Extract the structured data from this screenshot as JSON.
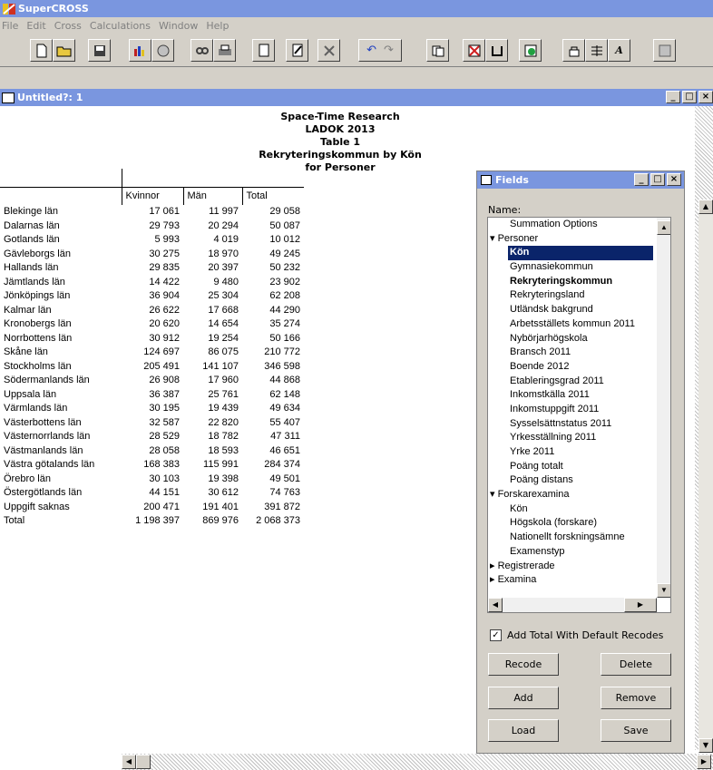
{
  "app": {
    "title": "SuperCROSS"
  },
  "menu": [
    "File",
    "Edit",
    "Cross",
    "Calculations",
    "Window",
    "Help"
  ],
  "toolbar": {
    "icons": [
      "new-icon",
      "open-icon",
      "save-icon",
      "chart-icon",
      "map-icon",
      "find-icon",
      "print-icon",
      "preview-icon",
      "edit-icon",
      "tools-icon",
      "undo-icon",
      "redo-icon",
      "paste-icon",
      "delete-icon",
      "clear-icon",
      "add-icon",
      "lock-icon",
      "columns-icon",
      "font-icon",
      "window-icon"
    ]
  },
  "window": {
    "title": "Untitled?: 1"
  },
  "report": {
    "line1": "Space-Time Research",
    "line2": "LADOK 2013",
    "line3": "Table 1",
    "line4": "Rekryteringskommun by Kön",
    "line5": "for Personer"
  },
  "table": {
    "columns": [
      "Kvinnor",
      "Män",
      "Total"
    ],
    "rows": [
      {
        "name": "Blekinge län",
        "k": "17 061",
        "m": "11 997",
        "t": "29 058"
      },
      {
        "name": "Dalarnas län",
        "k": "29 793",
        "m": "20 294",
        "t": "50 087"
      },
      {
        "name": "Gotlands län",
        "k": "5 993",
        "m": "4 019",
        "t": "10 012"
      },
      {
        "name": "Gävleborgs län",
        "k": "30 275",
        "m": "18 970",
        "t": "49 245"
      },
      {
        "name": "Hallands län",
        "k": "29 835",
        "m": "20 397",
        "t": "50 232"
      },
      {
        "name": "Jämtlands län",
        "k": "14 422",
        "m": "9 480",
        "t": "23 902"
      },
      {
        "name": "Jönköpings län",
        "k": "36 904",
        "m": "25 304",
        "t": "62 208"
      },
      {
        "name": "Kalmar län",
        "k": "26 622",
        "m": "17 668",
        "t": "44 290"
      },
      {
        "name": "Kronobergs län",
        "k": "20 620",
        "m": "14 654",
        "t": "35 274"
      },
      {
        "name": "Norrbottens län",
        "k": "30 912",
        "m": "19 254",
        "t": "50 166"
      },
      {
        "name": "Skåne län",
        "k": "124 697",
        "m": "86 075",
        "t": "210 772"
      },
      {
        "name": "Stockholms län",
        "k": "205 491",
        "m": "141 107",
        "t": "346 598"
      },
      {
        "name": "Södermanlands län",
        "k": "26 908",
        "m": "17 960",
        "t": "44 868"
      },
      {
        "name": "Uppsala län",
        "k": "36 387",
        "m": "25 761",
        "t": "62 148"
      },
      {
        "name": "Värmlands län",
        "k": "30 195",
        "m": "19 439",
        "t": "49 634"
      },
      {
        "name": "Västerbottens län",
        "k": "32 587",
        "m": "22 820",
        "t": "55 407"
      },
      {
        "name": "Västernorrlands län",
        "k": "28 529",
        "m": "18 782",
        "t": "47 311"
      },
      {
        "name": "Västmanlands län",
        "k": "28 058",
        "m": "18 593",
        "t": "46 651"
      },
      {
        "name": "Västra götalands län",
        "k": "168 383",
        "m": "115 991",
        "t": "284 374"
      },
      {
        "name": "Örebro län",
        "k": "30 103",
        "m": "19 398",
        "t": "49 501"
      },
      {
        "name": "Östergötlands län",
        "k": "44 151",
        "m": "30 612",
        "t": "74 763"
      },
      {
        "name": "Uppgift saknas",
        "k": "200 471",
        "m": "191 401",
        "t": "391 872"
      },
      {
        "name": "Total",
        "k": "1 198 397",
        "m": "869 976",
        "t": "2 068 373"
      }
    ]
  },
  "fields": {
    "title": "Fields",
    "name_label": "Name:",
    "tree": [
      {
        "label": "Summation Options",
        "level": "lvl1"
      },
      {
        "label": "Personer",
        "level": "lvl0",
        "prefix": "▾ "
      },
      {
        "label": "Kön",
        "level": "selected"
      },
      {
        "label": "Gymnasiekommun",
        "level": "lvl1"
      },
      {
        "label": "Rekryteringskommun",
        "level": "lvl1b"
      },
      {
        "label": "Rekryteringsland",
        "level": "lvl1"
      },
      {
        "label": "Utländsk bakgrund",
        "level": "lvl1"
      },
      {
        "label": "Arbetsställets kommun 2011",
        "level": "lvl1"
      },
      {
        "label": "Nybörjarhögskola",
        "level": "lvl1"
      },
      {
        "label": "Bransch 2011",
        "level": "lvl1"
      },
      {
        "label": "Boende 2012",
        "level": "lvl1"
      },
      {
        "label": "Etableringsgrad 2011",
        "level": "lvl1"
      },
      {
        "label": "Inkomstkälla 2011",
        "level": "lvl1"
      },
      {
        "label": "Inkomstuppgift 2011",
        "level": "lvl1"
      },
      {
        "label": "Sysselsättnstatus 2011",
        "level": "lvl1"
      },
      {
        "label": "Yrkesställning 2011",
        "level": "lvl1"
      },
      {
        "label": "Yrke 2011",
        "level": "lvl1"
      },
      {
        "label": "Poäng totalt",
        "level": "lvl1"
      },
      {
        "label": "Poäng distans",
        "level": "lvl1"
      },
      {
        "label": "Forskarexamina",
        "level": "lvl0",
        "prefix": "▾ "
      },
      {
        "label": "Kön",
        "level": "lvl1"
      },
      {
        "label": "Högskola (forskare)",
        "level": "lvl1"
      },
      {
        "label": "Nationellt forskningsämne",
        "level": "lvl1"
      },
      {
        "label": "Examenstyp",
        "level": "lvl1"
      },
      {
        "label": "Registrerade",
        "level": "lvl0",
        "prefix": "▸ "
      },
      {
        "label": "Examina",
        "level": "lvl0",
        "prefix": "▸ "
      }
    ],
    "checkbox_label": "Add Total With Default Recodes",
    "checkbox_checked": "✓",
    "buttons": {
      "recode": "Recode",
      "delete": "Delete",
      "add": "Add",
      "remove": "Remove",
      "load": "Load",
      "save": "Save"
    }
  }
}
